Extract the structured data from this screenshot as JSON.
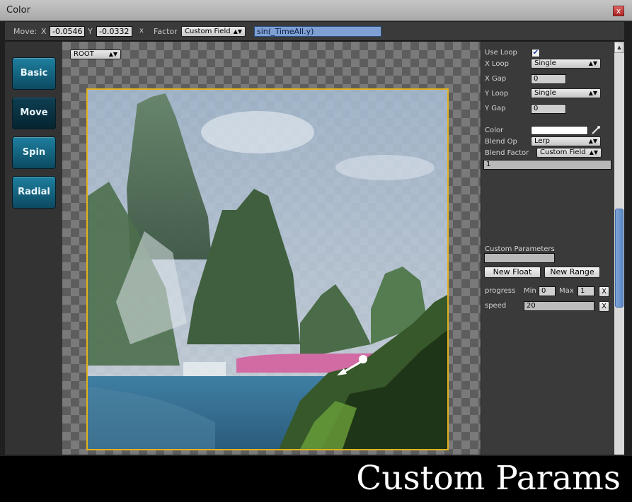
{
  "window": {
    "title": "Color",
    "close": "x"
  },
  "toolbar": {
    "move_label": "Move:",
    "x_label": "X",
    "x_value": "-0.0546",
    "y_label": "Y",
    "y_value": "-0.0332",
    "clear": "x",
    "factor_label": "Factor",
    "factor_value": "Custom Field",
    "formula": "sin(_TimeAll.y)"
  },
  "sidebar": {
    "items": [
      {
        "label": "Basic"
      },
      {
        "label": "Move"
      },
      {
        "label": "Spin"
      },
      {
        "label": "Radial"
      }
    ],
    "active": "Move"
  },
  "viewport": {
    "root": "ROOT"
  },
  "props": {
    "use_loop_label": "Use Loop",
    "use_loop_checked": "✔",
    "x_loop_label": "X Loop",
    "x_loop_value": "Single",
    "x_gap_label": "X Gap",
    "x_gap_value": "0",
    "y_loop_label": "Y Loop",
    "y_loop_value": "Single",
    "y_gap_label": "Y Gap",
    "y_gap_value": "0",
    "color_label": "Color",
    "color_value": "#ffffff",
    "blend_op_label": "Blend Op",
    "blend_op_value": "Lerp",
    "blend_factor_label": "Blend Factor",
    "blend_factor_value": "Custom Field",
    "blend_factor_field": "1"
  },
  "custom": {
    "title": "Custom Parameters",
    "name_value": "",
    "new_float": "New Float",
    "new_range": "New Range",
    "params": [
      {
        "name": "progress",
        "min_label": "Min",
        "min": "0",
        "max_label": "Max",
        "max": "1",
        "remove": "X"
      },
      {
        "name": "speed",
        "value": "20",
        "remove": "X"
      }
    ]
  },
  "caption": "Custom Params",
  "icons": {
    "dropdown": "chevron-updown-icon",
    "eyedropper": "eyedropper-icon",
    "check": "checkmark-icon"
  },
  "colors": {
    "accent_button": "#1e7f9f",
    "frame": "#e2b11e",
    "formula_highlight": "#7ea0d2"
  }
}
